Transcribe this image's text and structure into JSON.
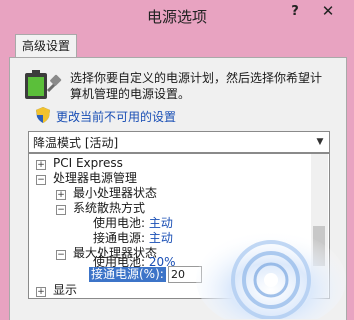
{
  "window": {
    "title": "电源选项",
    "help": "?",
    "close": "✕"
  },
  "tabs": [
    {
      "label": "高级设置"
    }
  ],
  "intro": {
    "line1": "选择你要自定义的电源计划，然后选择你希望计",
    "line2": "算机管理的电源设置。"
  },
  "change_link": "更改当前不可用的设置",
  "plan_select": {
    "value": "降温模式 [活动]"
  },
  "tree": {
    "pci_express": "PCI Express",
    "processor_mgmt": "处理器电源管理",
    "min_state": "最小处理器状态",
    "cooling": "系统散热方式",
    "cooling_battery_label": "使用电池:",
    "cooling_battery_value": "主动",
    "cooling_plugged_label": "接通电源:",
    "cooling_plugged_value": "主动",
    "max_state": "最大处理器状态",
    "max_battery_label": "使用电池:",
    "max_battery_value": "20%",
    "max_plugged_label": "接通电源(%):",
    "max_plugged_value": "20",
    "display": "显示"
  },
  "colors": {
    "accent": "#e8a3c1",
    "link": "#1a4fb5",
    "selection": "#3c74c8"
  }
}
